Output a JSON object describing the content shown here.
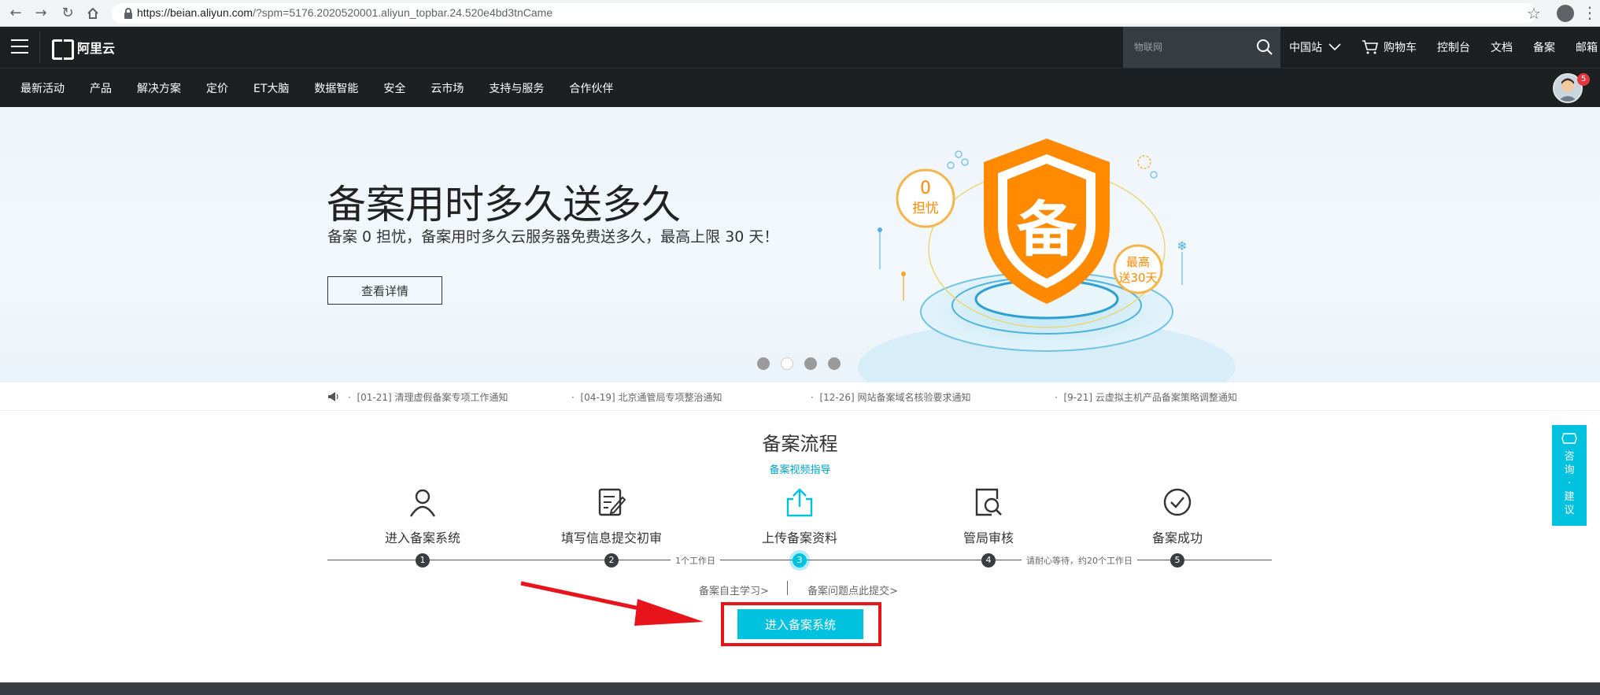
{
  "browser": {
    "url_host": "https://beian.aliyun.com",
    "url_rest": "/?spm=5176.2020520001.aliyun_topbar.24.520e4bd3tnCame"
  },
  "topbar": {
    "logo_text": "阿里云",
    "search_placeholder": "物联网",
    "links": [
      "中国站",
      "购物车",
      "控制台",
      "文档",
      "备案",
      "邮箱"
    ]
  },
  "nav": {
    "items": [
      "最新活动",
      "产品",
      "解决方案",
      "定价",
      "ET大脑",
      "数据智能",
      "安全",
      "云市场",
      "支持与服务",
      "合作伙伴"
    ],
    "avatar_badge": "5"
  },
  "banner": {
    "title": "备案用时多久送多久",
    "subtitle": "备案 0 担忧，备案用时多久云服务器免费送多久，最高上限 30 天！",
    "button": "查看详情",
    "art_badge_left_top": "0",
    "art_badge_left_bottom": "担忧",
    "art_shield_char": "备",
    "art_badge_right_top": "最高",
    "art_badge_right_bottom": "送30天",
    "carousel_count": 4,
    "carousel_active": 2
  },
  "notices": [
    "[01-21]  清理虚假备案专项工作通知",
    "[04-19]  北京通管局专项整治通知",
    "[12-26]  网站备案域名核验要求通知",
    "[9-21]  云虚拟主机产品备案策略调整通知"
  ],
  "process": {
    "title": "备案流程",
    "video_link": "备案视频指导",
    "steps": [
      {
        "label": "进入备案系统",
        "num": "1"
      },
      {
        "label": "填写信息提交初审",
        "num": "2"
      },
      {
        "label": "上传备案资料",
        "num": "3"
      },
      {
        "label": "管局审核",
        "num": "4"
      },
      {
        "label": "备案成功",
        "num": "5"
      }
    ],
    "note_1": "1个工作日",
    "note_2": "请耐心等待，约20个工作日",
    "help_self": "备案自主学习>",
    "help_issue": "备案问题点此提交>",
    "enter_button": "进入备案系统"
  },
  "side": {
    "consult_chars": [
      "咨",
      "询",
      "·",
      "建",
      "议"
    ]
  },
  "colors": {
    "accent": "#00c1de",
    "topbar": "#1c2023",
    "highlight_red": "#e8141c",
    "banner_orange": "#ff8a00"
  }
}
